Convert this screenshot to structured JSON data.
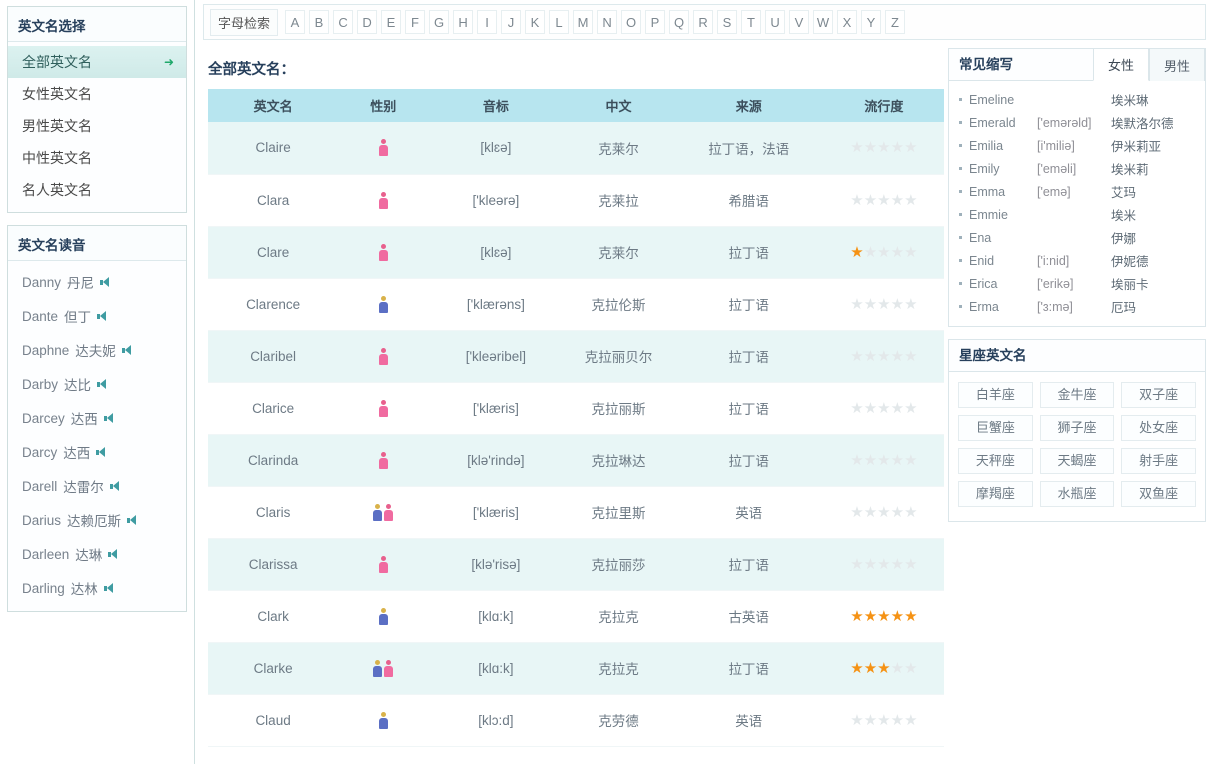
{
  "left_sidebar": {
    "select_panel": {
      "title": "英文名选择",
      "items": [
        {
          "label": "全部英文名",
          "active": true,
          "arrow": "➜"
        },
        {
          "label": "女性英文名",
          "active": false
        },
        {
          "label": "男性英文名",
          "active": false
        },
        {
          "label": "中性英文名",
          "active": false
        },
        {
          "label": "名人英文名",
          "active": false
        }
      ]
    },
    "pronounce_panel": {
      "title": "英文名读音",
      "speaker_icon": "speaker-icon",
      "items": [
        {
          "en": "Danny",
          "cn": "丹尼"
        },
        {
          "en": "Dante",
          "cn": "但丁"
        },
        {
          "en": "Daphne",
          "cn": "达夫妮"
        },
        {
          "en": "Darby",
          "cn": "达比"
        },
        {
          "en": "Darcey",
          "cn": "达西"
        },
        {
          "en": "Darcy",
          "cn": "达西"
        },
        {
          "en": "Darell",
          "cn": "达雷尔"
        },
        {
          "en": "Darius",
          "cn": "达赖厄斯"
        },
        {
          "en": "Darleen",
          "cn": "达琳"
        },
        {
          "en": "Darling",
          "cn": "达林"
        }
      ]
    }
  },
  "alpha_bar": {
    "label": "字母检索",
    "letters": [
      "A",
      "B",
      "C",
      "D",
      "E",
      "F",
      "G",
      "H",
      "I",
      "J",
      "K",
      "L",
      "M",
      "N",
      "O",
      "P",
      "Q",
      "R",
      "S",
      "T",
      "U",
      "V",
      "W",
      "X",
      "Y",
      "Z"
    ]
  },
  "main": {
    "heading": "全部英文名：",
    "columns": [
      "英文名",
      "性别",
      "音标",
      "中文",
      "来源",
      "流行度"
    ],
    "rows": [
      {
        "name": "Claire",
        "gender": "f",
        "ipa": "[klɛə]",
        "cn": "克莱尔",
        "source": "拉丁语，法语",
        "stars": 0
      },
      {
        "name": "Clara",
        "gender": "f",
        "ipa": "['kleərə]",
        "cn": "克莱拉",
        "source": "希腊语",
        "stars": 0
      },
      {
        "name": "Clare",
        "gender": "f",
        "ipa": "[klɛə]",
        "cn": "克莱尔",
        "source": "拉丁语",
        "stars": 1
      },
      {
        "name": "Clarence",
        "gender": "m",
        "ipa": "['klærəns]",
        "cn": "克拉伦斯",
        "source": "拉丁语",
        "stars": 0
      },
      {
        "name": "Claribel",
        "gender": "f",
        "ipa": "['kleəribel]",
        "cn": "克拉丽贝尔",
        "source": "拉丁语",
        "stars": 0
      },
      {
        "name": "Clarice",
        "gender": "f",
        "ipa": "['klæris]",
        "cn": "克拉丽斯",
        "source": "拉丁语",
        "stars": 0
      },
      {
        "name": "Clarinda",
        "gender": "f",
        "ipa": "[klə'rində]",
        "cn": "克拉琳达",
        "source": "拉丁语",
        "stars": 0
      },
      {
        "name": "Claris",
        "gender": "mf",
        "ipa": "['klæris]",
        "cn": "克拉里斯",
        "source": "英语",
        "stars": 0
      },
      {
        "name": "Clarissa",
        "gender": "f",
        "ipa": "[klə'risə]",
        "cn": "克拉丽莎",
        "source": "拉丁语",
        "stars": 0
      },
      {
        "name": "Clark",
        "gender": "m",
        "ipa": "[klɑ:k]",
        "cn": "克拉克",
        "source": "古英语",
        "stars": 5
      },
      {
        "name": "Clarke",
        "gender": "mf",
        "ipa": "[klɑ:k]",
        "cn": "克拉克",
        "source": "拉丁语",
        "stars": 3
      },
      {
        "name": "Claud",
        "gender": "m",
        "ipa": "[klɔ:d]",
        "cn": "克劳德",
        "source": "英语",
        "stars": 0
      }
    ]
  },
  "right_sidebar": {
    "abbr_panel": {
      "title": "常见缩写",
      "tabs": [
        {
          "label": "女性",
          "active": true
        },
        {
          "label": "男性",
          "active": false
        }
      ],
      "items": [
        {
          "en": "Emeline",
          "ipa": "",
          "cn": "埃米琳"
        },
        {
          "en": "Emerald",
          "ipa": "['emərəld]",
          "cn": "埃默洛尔德"
        },
        {
          "en": "Emilia",
          "ipa": "[i'miliə]",
          "cn": "伊米莉亚"
        },
        {
          "en": "Emily",
          "ipa": "['eməli]",
          "cn": "埃米莉"
        },
        {
          "en": "Emma",
          "ipa": "['emə]",
          "cn": "艾玛"
        },
        {
          "en": "Emmie",
          "ipa": "",
          "cn": "埃米"
        },
        {
          "en": "Ena",
          "ipa": "",
          "cn": "伊娜"
        },
        {
          "en": "Enid",
          "ipa": "['i:nid]",
          "cn": "伊妮德"
        },
        {
          "en": "Erica",
          "ipa": "['erikə]",
          "cn": "埃丽卡"
        },
        {
          "en": "Erma",
          "ipa": "['ɜ:mə]",
          "cn": "厄玛"
        }
      ]
    },
    "zodiac_panel": {
      "title": "星座英文名",
      "items": [
        "白羊座",
        "金牛座",
        "双子座",
        "巨蟹座",
        "狮子座",
        "处女座",
        "天秤座",
        "天蝎座",
        "射手座",
        "摩羯座",
        "水瓶座",
        "双鱼座"
      ]
    }
  },
  "colors": {
    "table_header_bg": "#b7e5ef",
    "row_alt_bg": "#e8f6f6",
    "star_on": "#f59214",
    "star_off": "#e3e8ea",
    "title_text": "#27405c",
    "active_nav_bg": "#d6efed",
    "female_icon": "#f06ba0",
    "male_icon": "#5b6fc4",
    "speaker_icon": "#3f9ca2"
  }
}
